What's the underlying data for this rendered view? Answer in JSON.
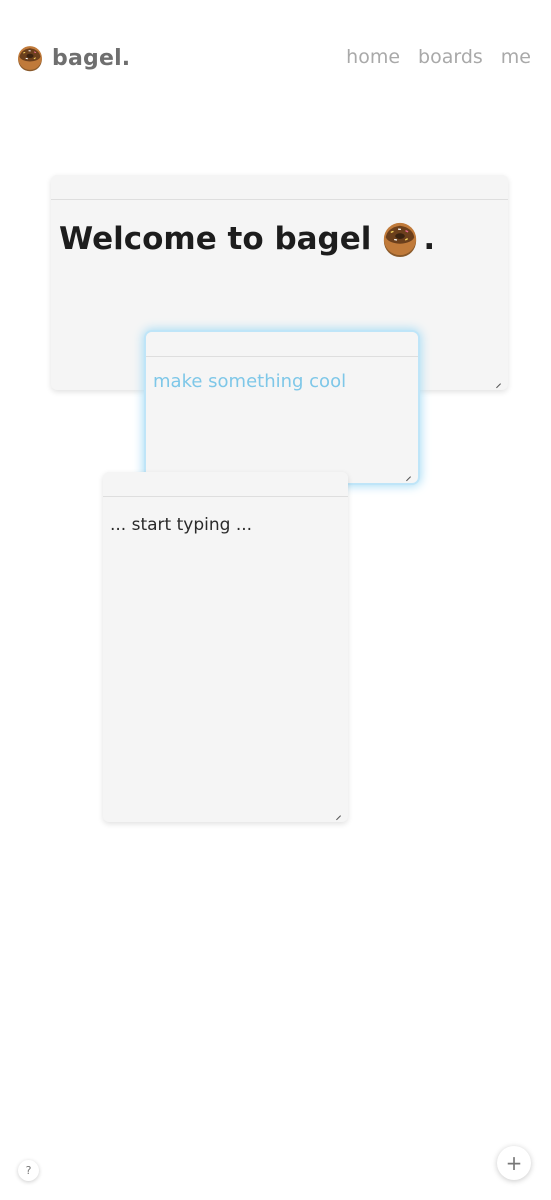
{
  "header": {
    "brand_name": "bagel.",
    "logo_icon": "donut-icon",
    "nav": [
      {
        "label": "home"
      },
      {
        "label": "boards"
      },
      {
        "label": "me"
      }
    ]
  },
  "cards": [
    {
      "text": "Welcome to bagel",
      "trailing": ".",
      "icon": "donut-icon"
    },
    {
      "text": "make something cool"
    },
    {
      "text": "... start typing ..."
    }
  ],
  "controls": {
    "help_label": "?",
    "add_label": "+"
  },
  "colors": {
    "accent": "#7ec7e8",
    "card_bg": "#f5f5f5",
    "nav_text": "#a9a9a9"
  }
}
